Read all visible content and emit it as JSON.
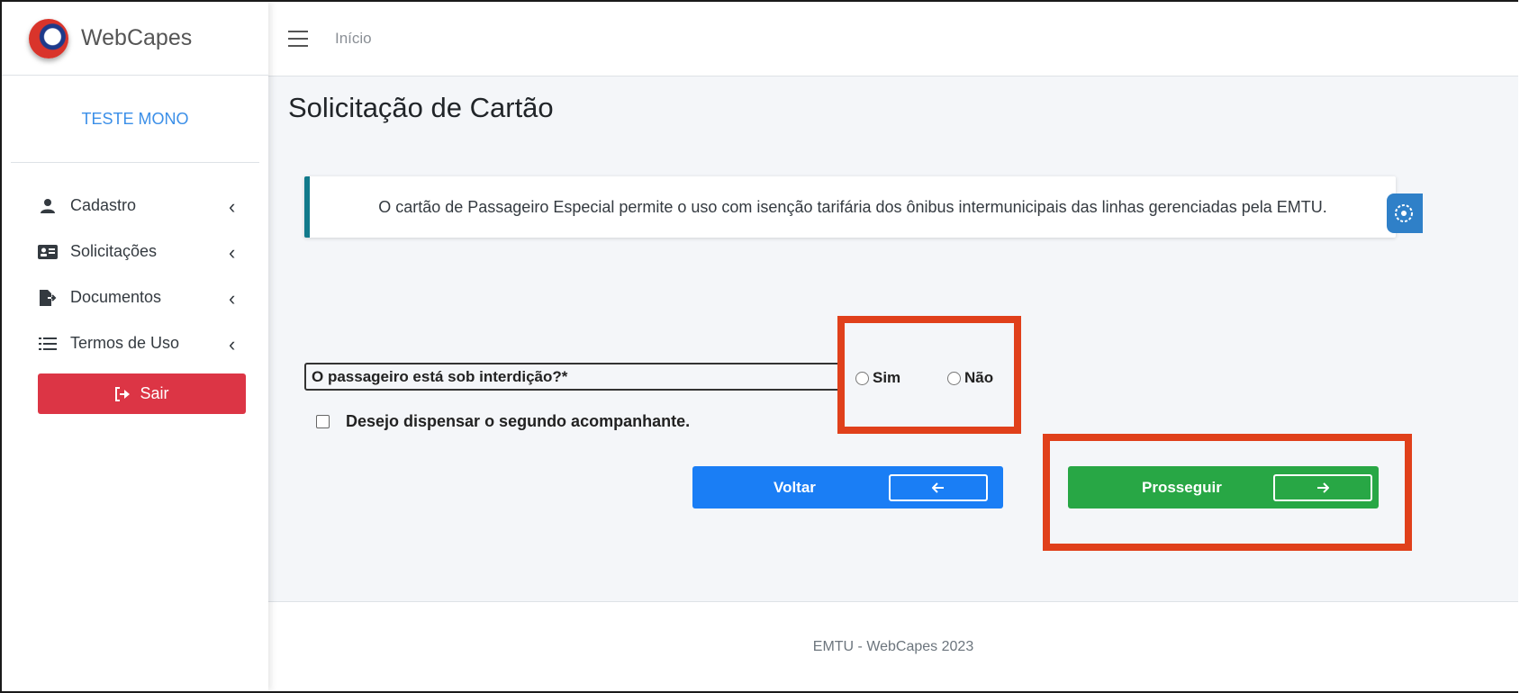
{
  "brand": {
    "name": "WebCapes"
  },
  "user": {
    "name": "TESTE MONO"
  },
  "sidebar": {
    "items": [
      {
        "label": "Cadastro"
      },
      {
        "label": "Solicitações"
      },
      {
        "label": "Documentos"
      },
      {
        "label": "Termos de Uso"
      }
    ],
    "logout_label": "Sair"
  },
  "topbar": {
    "breadcrumb": "Início"
  },
  "main": {
    "title": "Solicitação de Cartão",
    "callout": "O cartão de Passageiro Especial permite o uso com isenção tarifária dos ônibus intermunicipais das linhas gerenciadas pela EMTU.",
    "question": "O passageiro está sob interdição?*",
    "options": [
      "Sim",
      "Não"
    ],
    "checkbox_label": "Desejo dispensar o segundo acompanhante.",
    "back_label": "Voltar",
    "next_label": "Prosseguir"
  },
  "footer": {
    "text": "EMTU - WebCapes 2023"
  },
  "colors": {
    "accent": "#1a7ef5",
    "success": "#28a745",
    "danger": "#dc3545",
    "info": "#117a8b",
    "highlight": "#e0401b"
  }
}
